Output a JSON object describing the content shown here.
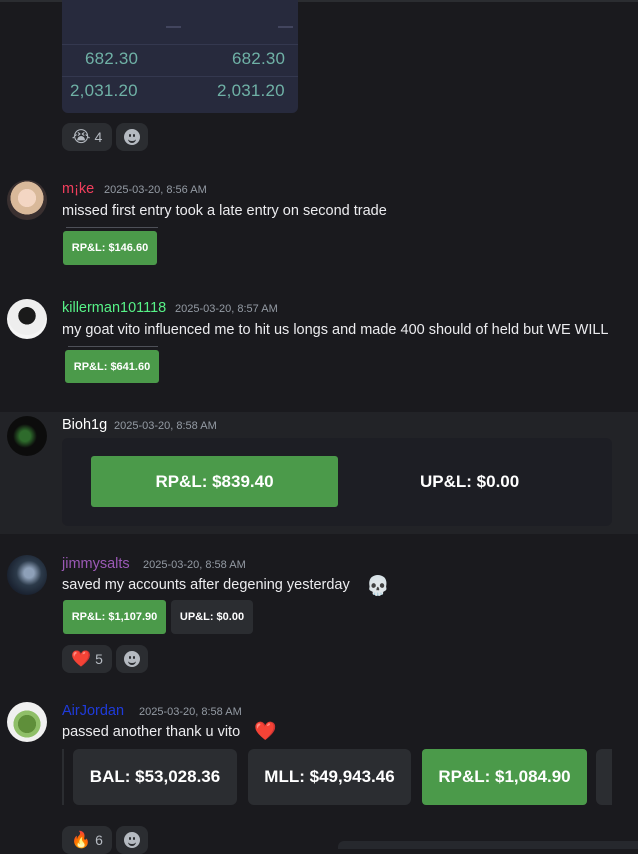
{
  "table": {
    "dash_left": "—",
    "dash_right": "—",
    "row1": {
      "left": "682.30",
      "right": "682.30"
    },
    "row2": {
      "left": "2,031.20",
      "right": "2,031.20"
    }
  },
  "reactions_top": {
    "emoji": "😭",
    "count": "4"
  },
  "messages": [
    {
      "username": "m¡ke",
      "username_color": "#f23f5d",
      "timestamp": "2025-03-20, 8:56 AM",
      "text": "missed first entry took a late entry on second trade",
      "pill": "RP&L: $146.60"
    },
    {
      "username": "killerman101118",
      "username_color": "#57f287",
      "timestamp": "2025-03-20, 8:57 AM",
      "text": "my goat vito influenced me to hit us longs and made 400 should of held but WE WILL",
      "pill": "RP&L: $641.60"
    },
    {
      "username": "Bioh1g",
      "username_color": "#ffffff",
      "timestamp": "2025-03-20, 8:58 AM",
      "rpl": "RP&L: $839.40",
      "upl": "UP&L: $0.00"
    },
    {
      "username": "jimmysalts",
      "username_color": "#9b59b6",
      "timestamp": "2025-03-20, 8:58 AM",
      "text": "saved my accounts after degening yesterday",
      "emoji": "💀",
      "rpl": "RP&L: $1,107.90",
      "upl": "UP&L: $0.00",
      "reaction": {
        "emoji": "❤️",
        "count": "5"
      }
    },
    {
      "username": "AirJordan",
      "username_color": "#1f3bdb",
      "timestamp": "2025-03-20, 8:58 AM",
      "text": "passed another thank u vito",
      "emoji": "❤️",
      "bal": "BAL: $53,028.36",
      "mll": "MLL: $49,943.46",
      "rpl": "RP&L: $1,084.90",
      "reaction": {
        "emoji": "🔥",
        "count": "6"
      }
    }
  ],
  "icons": {
    "add_reaction": "add-reaction-icon"
  },
  "colors": {
    "green": "#4b9a4a",
    "accent": "#6fb1a6"
  }
}
